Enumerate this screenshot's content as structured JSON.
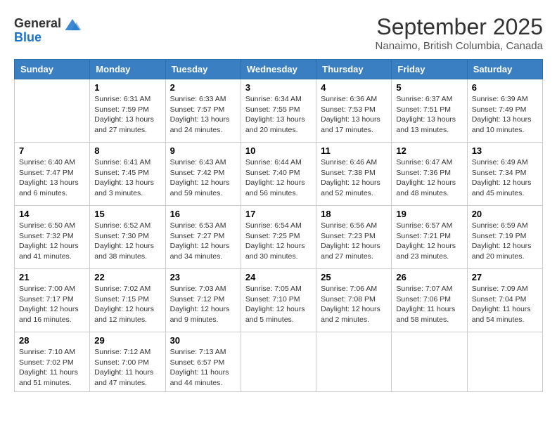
{
  "header": {
    "logo_line1": "General",
    "logo_line2": "Blue",
    "title": "September 2025",
    "subtitle": "Nanaimo, British Columbia, Canada"
  },
  "columns": [
    "Sunday",
    "Monday",
    "Tuesday",
    "Wednesday",
    "Thursday",
    "Friday",
    "Saturday"
  ],
  "weeks": [
    [
      {
        "day": "",
        "info": ""
      },
      {
        "day": "1",
        "info": "Sunrise: 6:31 AM\nSunset: 7:59 PM\nDaylight: 13 hours and 27 minutes."
      },
      {
        "day": "2",
        "info": "Sunrise: 6:33 AM\nSunset: 7:57 PM\nDaylight: 13 hours and 24 minutes."
      },
      {
        "day": "3",
        "info": "Sunrise: 6:34 AM\nSunset: 7:55 PM\nDaylight: 13 hours and 20 minutes."
      },
      {
        "day": "4",
        "info": "Sunrise: 6:36 AM\nSunset: 7:53 PM\nDaylight: 13 hours and 17 minutes."
      },
      {
        "day": "5",
        "info": "Sunrise: 6:37 AM\nSunset: 7:51 PM\nDaylight: 13 hours and 13 minutes."
      },
      {
        "day": "6",
        "info": "Sunrise: 6:39 AM\nSunset: 7:49 PM\nDaylight: 13 hours and 10 minutes."
      }
    ],
    [
      {
        "day": "7",
        "info": "Sunrise: 6:40 AM\nSunset: 7:47 PM\nDaylight: 13 hours and 6 minutes."
      },
      {
        "day": "8",
        "info": "Sunrise: 6:41 AM\nSunset: 7:45 PM\nDaylight: 13 hours and 3 minutes."
      },
      {
        "day": "9",
        "info": "Sunrise: 6:43 AM\nSunset: 7:42 PM\nDaylight: 12 hours and 59 minutes."
      },
      {
        "day": "10",
        "info": "Sunrise: 6:44 AM\nSunset: 7:40 PM\nDaylight: 12 hours and 56 minutes."
      },
      {
        "day": "11",
        "info": "Sunrise: 6:46 AM\nSunset: 7:38 PM\nDaylight: 12 hours and 52 minutes."
      },
      {
        "day": "12",
        "info": "Sunrise: 6:47 AM\nSunset: 7:36 PM\nDaylight: 12 hours and 48 minutes."
      },
      {
        "day": "13",
        "info": "Sunrise: 6:49 AM\nSunset: 7:34 PM\nDaylight: 12 hours and 45 minutes."
      }
    ],
    [
      {
        "day": "14",
        "info": "Sunrise: 6:50 AM\nSunset: 7:32 PM\nDaylight: 12 hours and 41 minutes."
      },
      {
        "day": "15",
        "info": "Sunrise: 6:52 AM\nSunset: 7:30 PM\nDaylight: 12 hours and 38 minutes."
      },
      {
        "day": "16",
        "info": "Sunrise: 6:53 AM\nSunset: 7:27 PM\nDaylight: 12 hours and 34 minutes."
      },
      {
        "day": "17",
        "info": "Sunrise: 6:54 AM\nSunset: 7:25 PM\nDaylight: 12 hours and 30 minutes."
      },
      {
        "day": "18",
        "info": "Sunrise: 6:56 AM\nSunset: 7:23 PM\nDaylight: 12 hours and 27 minutes."
      },
      {
        "day": "19",
        "info": "Sunrise: 6:57 AM\nSunset: 7:21 PM\nDaylight: 12 hours and 23 minutes."
      },
      {
        "day": "20",
        "info": "Sunrise: 6:59 AM\nSunset: 7:19 PM\nDaylight: 12 hours and 20 minutes."
      }
    ],
    [
      {
        "day": "21",
        "info": "Sunrise: 7:00 AM\nSunset: 7:17 PM\nDaylight: 12 hours and 16 minutes."
      },
      {
        "day": "22",
        "info": "Sunrise: 7:02 AM\nSunset: 7:15 PM\nDaylight: 12 hours and 12 minutes."
      },
      {
        "day": "23",
        "info": "Sunrise: 7:03 AM\nSunset: 7:12 PM\nDaylight: 12 hours and 9 minutes."
      },
      {
        "day": "24",
        "info": "Sunrise: 7:05 AM\nSunset: 7:10 PM\nDaylight: 12 hours and 5 minutes."
      },
      {
        "day": "25",
        "info": "Sunrise: 7:06 AM\nSunset: 7:08 PM\nDaylight: 12 hours and 2 minutes."
      },
      {
        "day": "26",
        "info": "Sunrise: 7:07 AM\nSunset: 7:06 PM\nDaylight: 11 hours and 58 minutes."
      },
      {
        "day": "27",
        "info": "Sunrise: 7:09 AM\nSunset: 7:04 PM\nDaylight: 11 hours and 54 minutes."
      }
    ],
    [
      {
        "day": "28",
        "info": "Sunrise: 7:10 AM\nSunset: 7:02 PM\nDaylight: 11 hours and 51 minutes."
      },
      {
        "day": "29",
        "info": "Sunrise: 7:12 AM\nSunset: 7:00 PM\nDaylight: 11 hours and 47 minutes."
      },
      {
        "day": "30",
        "info": "Sunrise: 7:13 AM\nSunset: 6:57 PM\nDaylight: 11 hours and 44 minutes."
      },
      {
        "day": "",
        "info": ""
      },
      {
        "day": "",
        "info": ""
      },
      {
        "day": "",
        "info": ""
      },
      {
        "day": "",
        "info": ""
      }
    ]
  ]
}
